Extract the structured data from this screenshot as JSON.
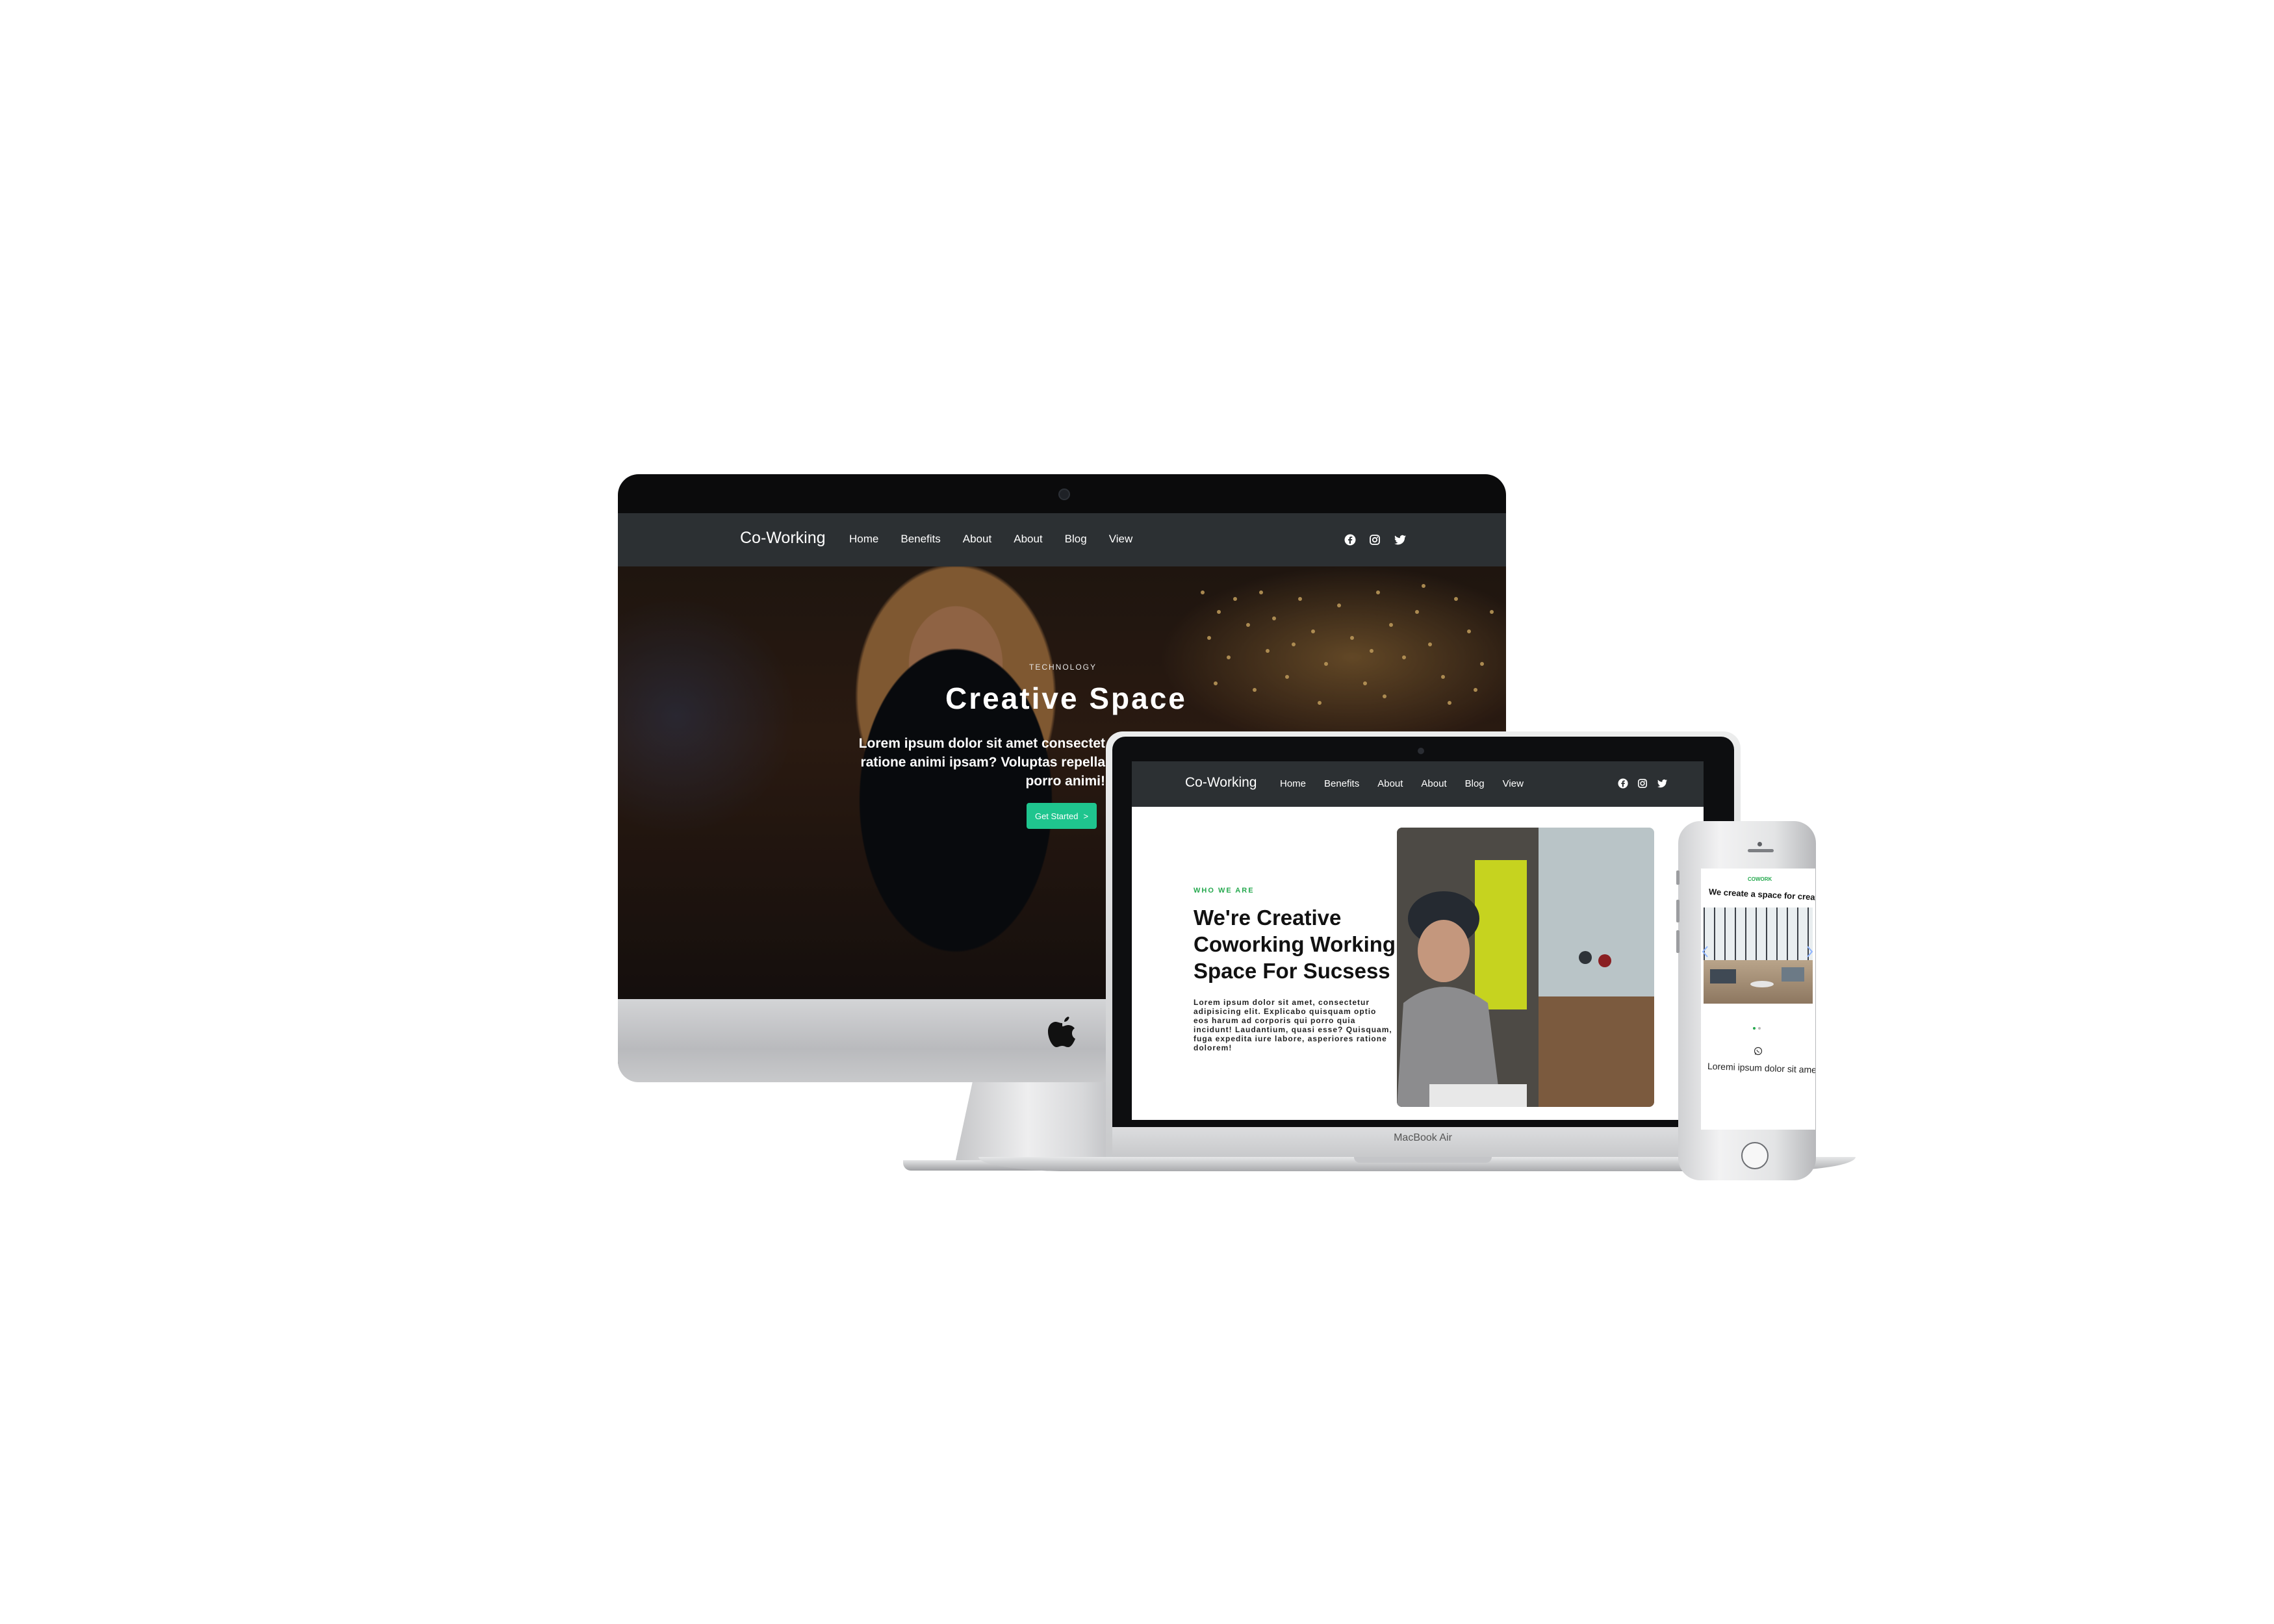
{
  "desktop": {
    "brand": "Co-Working",
    "nav": [
      "Home",
      "Benefits",
      "About",
      "About",
      "Blog",
      "View"
    ],
    "hero": {
      "kicker": "TECHNOLOGY",
      "title": "Creative Space",
      "text_line1": "Lorem ipsum dolor sit amet consectet",
      "text_line2": "ratione animi ipsam? Voluptas repella",
      "text_line3": "porro animi!",
      "button_label": "Get Started",
      "button_arrow": ">"
    }
  },
  "laptop": {
    "brand": "Co-Working",
    "nav": [
      "Home",
      "Benefits",
      "About",
      "About",
      "Blog",
      "View"
    ],
    "kicker": "WHO WE ARE",
    "title_line1": "We're Creative",
    "title_line2": "Coworking Working",
    "title_line3": "Space For Sucsess",
    "body_line1": "Lorem ipsum dolor sit amet, consectetur",
    "body_line2": "adipisicing elit. Explicabo quisquam optio",
    "body_line3": "eos harum ad corporis qui porro quia",
    "body_line4": "incidunt! Laudantium, quasi esse? Quisquam,",
    "body_line5": "fuga expedita iure labore, asperiores ratione",
    "body_line6": "dolorem!",
    "device_label": "MacBook Air"
  },
  "phone": {
    "kicker": "COWORK",
    "title": "We create a space for creativity",
    "text": "Loremi ipsum dolor sit amet,"
  },
  "colors": {
    "accent_green": "#1fc58e",
    "kicker_green": "#26a94f",
    "nav_bg": "#2c3033"
  },
  "icons": [
    "facebook-icon",
    "instagram-icon",
    "twitter-icon",
    "apple-logo",
    "whatsapp-icon"
  ]
}
